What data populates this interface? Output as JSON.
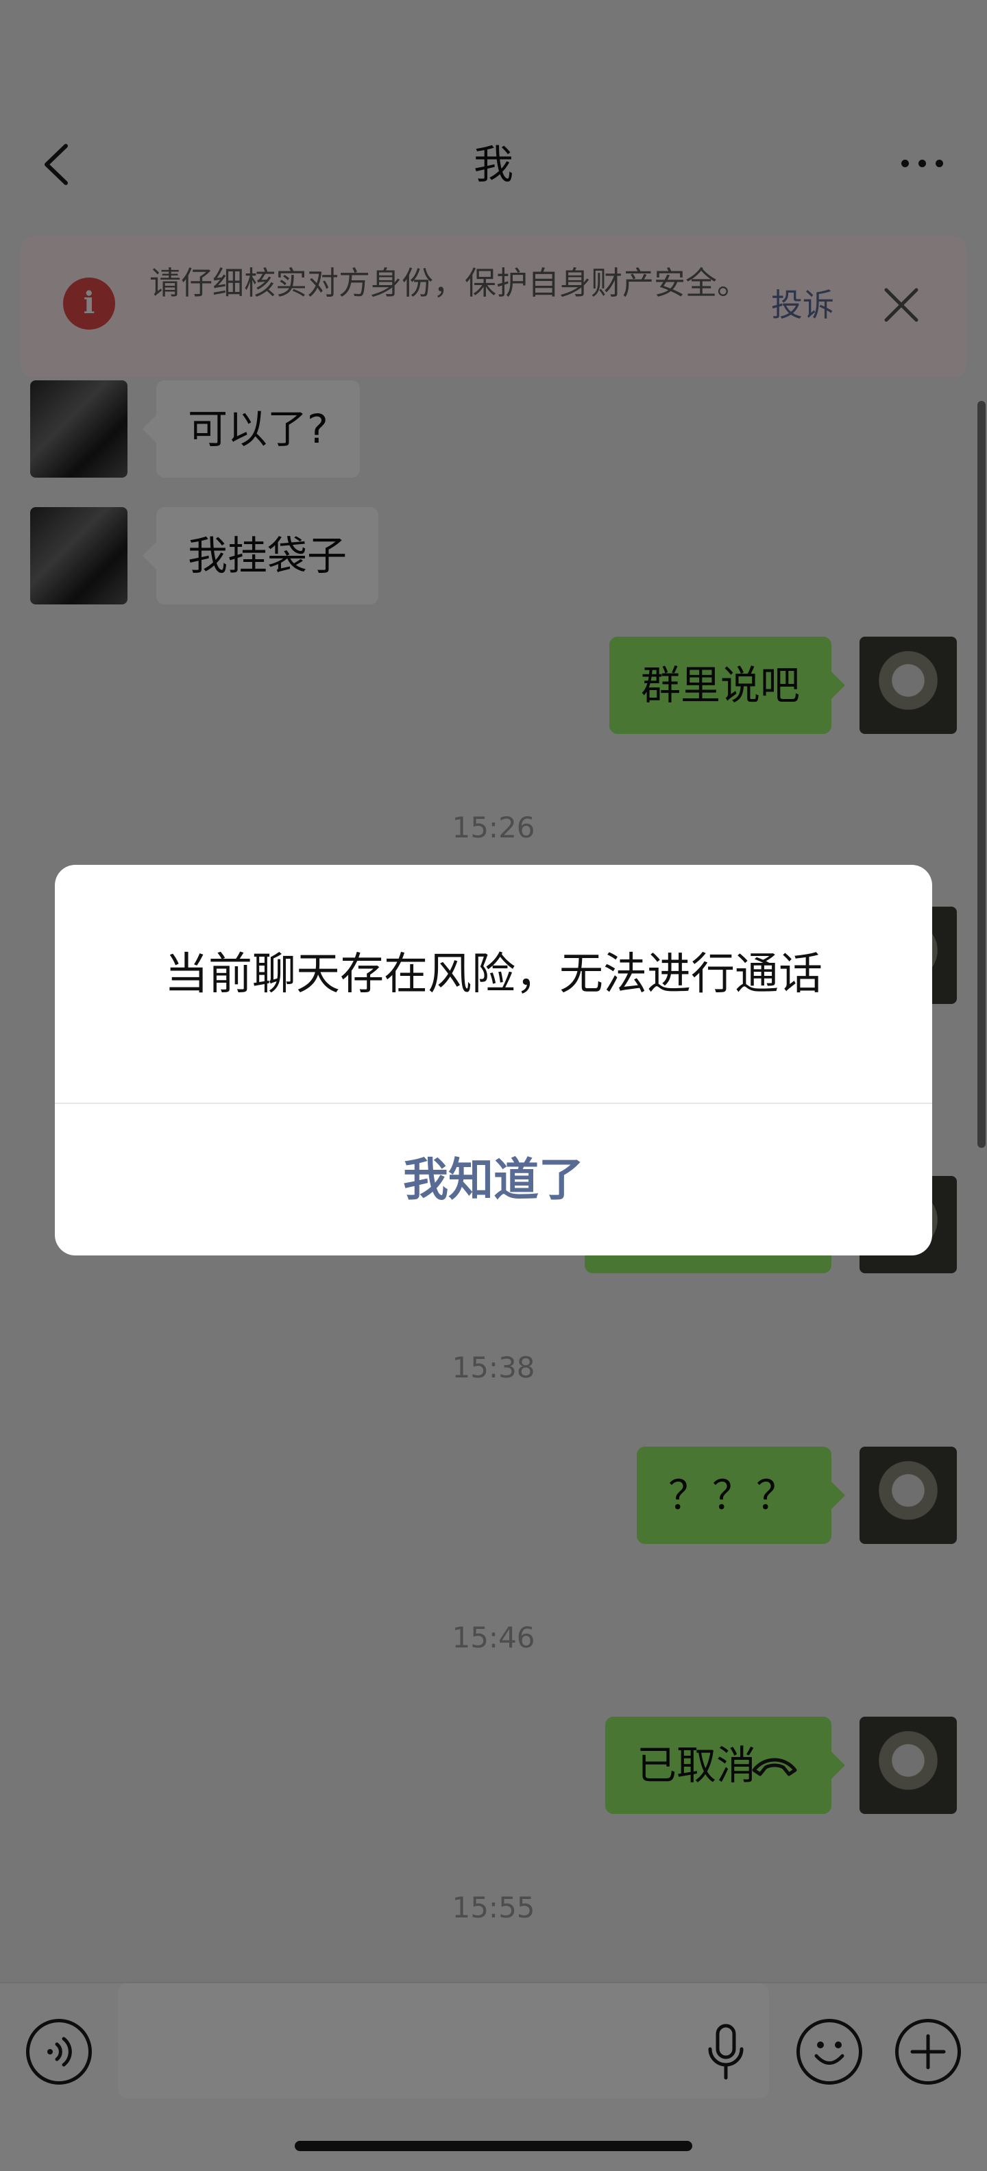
{
  "header": {
    "title": "我"
  },
  "banner": {
    "message": "请仔细核实对方身份，保护自身财产安全。",
    "complain_label": "投诉"
  },
  "messages": [
    {
      "side": "left",
      "text": "可以了?"
    },
    {
      "side": "left",
      "text": "我挂袋子"
    },
    {
      "side": "right",
      "text": "群里说吧"
    }
  ],
  "timestamps": [
    "15:26",
    "15:38",
    "15:46",
    "15:55"
  ],
  "later_messages": [
    {
      "side": "right",
      "text": "？？？"
    },
    {
      "side": "right",
      "text": "已取消"
    }
  ],
  "dialog": {
    "message": "当前聊天存在风险，无法进行通话",
    "confirm_label": "我知道了"
  },
  "icons": {
    "back": "chevron-left-icon",
    "more": "more-dots-icon",
    "warning": "info-icon",
    "close": "close-icon",
    "voice": "voice-icon",
    "mic": "microphone-icon",
    "emoji": "emoji-icon",
    "plus": "plus-icon",
    "hangup": "phone-hangup-icon"
  },
  "colors": {
    "bubble_self": "#95ec69",
    "bubble_other": "#ffffff",
    "link": "#576b95",
    "warning_red": "#e04848"
  }
}
